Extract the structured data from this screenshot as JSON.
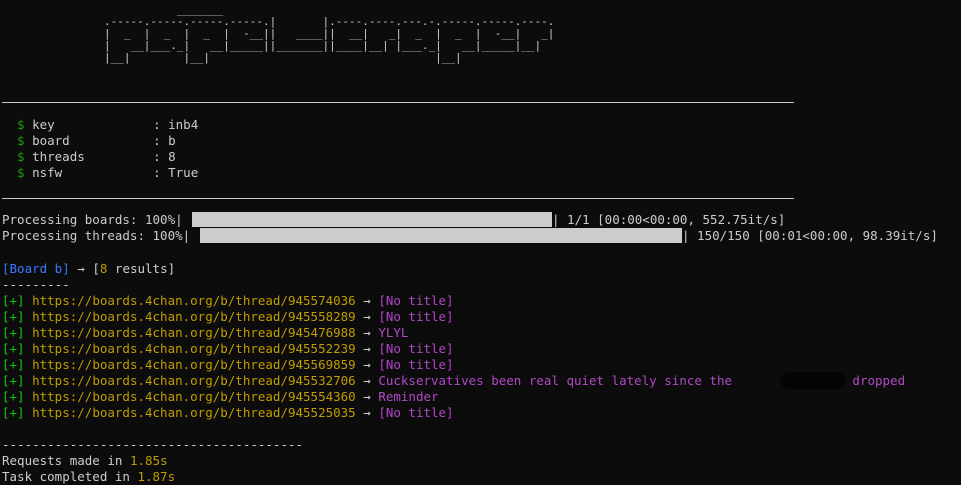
{
  "banner": "           _______\n.-----.-----.-----.-----.|       |.----.----.---.-.-----.-----.----.\n|  _  |  _  |  _  |  -__||   ____||  __|   _|  _  |  _  |  -__|   _|\n|   __|___._|   __|_____||_______||____|__| |___._|   __|_____|__|\n|__|        |__|                                  |__|",
  "config": [
    {
      "prompt": "$",
      "key": "key",
      "sep": ":",
      "value": "inb4"
    },
    {
      "prompt": "$",
      "key": "board",
      "sep": ":",
      "value": "b"
    },
    {
      "prompt": "$",
      "key": "threads",
      "sep": ":",
      "value": "8"
    },
    {
      "prompt": "$",
      "key": "nsfw",
      "sep": ":",
      "value": "True"
    }
  ],
  "progress": [
    {
      "label": "Processing boards: 100%|",
      "end": "| 1/1 [00:00<00:00, 552.75it/s]",
      "percent": 100
    },
    {
      "label": "Processing threads: 100%|",
      "end": "| 150/150 [00:01<00:00, 98.39it/s]",
      "percent": 100
    }
  ],
  "summary": {
    "board": "[Board b]",
    "arrow": "→",
    "results": "[8 results]",
    "dashes": "---------"
  },
  "results": [
    {
      "mark": "[+]",
      "url": "https://boards.4chan.org/b/thread/945574036",
      "arrow": "→",
      "title": "[No title]"
    },
    {
      "mark": "[+]",
      "url": "https://boards.4chan.org/b/thread/945558289",
      "arrow": "→",
      "title": "[No title]"
    },
    {
      "mark": "[+]",
      "url": "https://boards.4chan.org/b/thread/945476988",
      "arrow": "→",
      "title": "YLYL"
    },
    {
      "mark": "[+]",
      "url": "https://boards.4chan.org/b/thread/945552239",
      "arrow": "→",
      "title": "[No title]"
    },
    {
      "mark": "[+]",
      "url": "https://boards.4chan.org/b/thread/945569859",
      "arrow": "→",
      "title": "[No title]"
    },
    {
      "mark": "[+]",
      "url": "https://boards.4chan.org/b/thread/945532706",
      "arrow": "→",
      "title": "Cuckservatives been real quiet lately since the          files dropped"
    },
    {
      "mark": "[+]",
      "url": "https://boards.4chan.org/b/thread/945554360",
      "arrow": "→",
      "title": "Reminder"
    },
    {
      "mark": "[+]",
      "url": "https://boards.4chan.org/b/thread/945525035",
      "arrow": "→",
      "title": "[No title]"
    }
  ],
  "footer": {
    "dashes": "----------------------------------------",
    "requests_label": "Requests made in ",
    "requests_value": "1.85s",
    "task_label": "Task completed in ",
    "task_value": "1.87s"
  },
  "colors": {
    "background": "#0c0c0c",
    "text": "#cccccc",
    "prompt_green": "#13a10e",
    "bracket_green": "#16c60c",
    "url_yellow": "#c19c00",
    "board_blue": "#3b78ff",
    "title_magenta": "#b148c6"
  }
}
